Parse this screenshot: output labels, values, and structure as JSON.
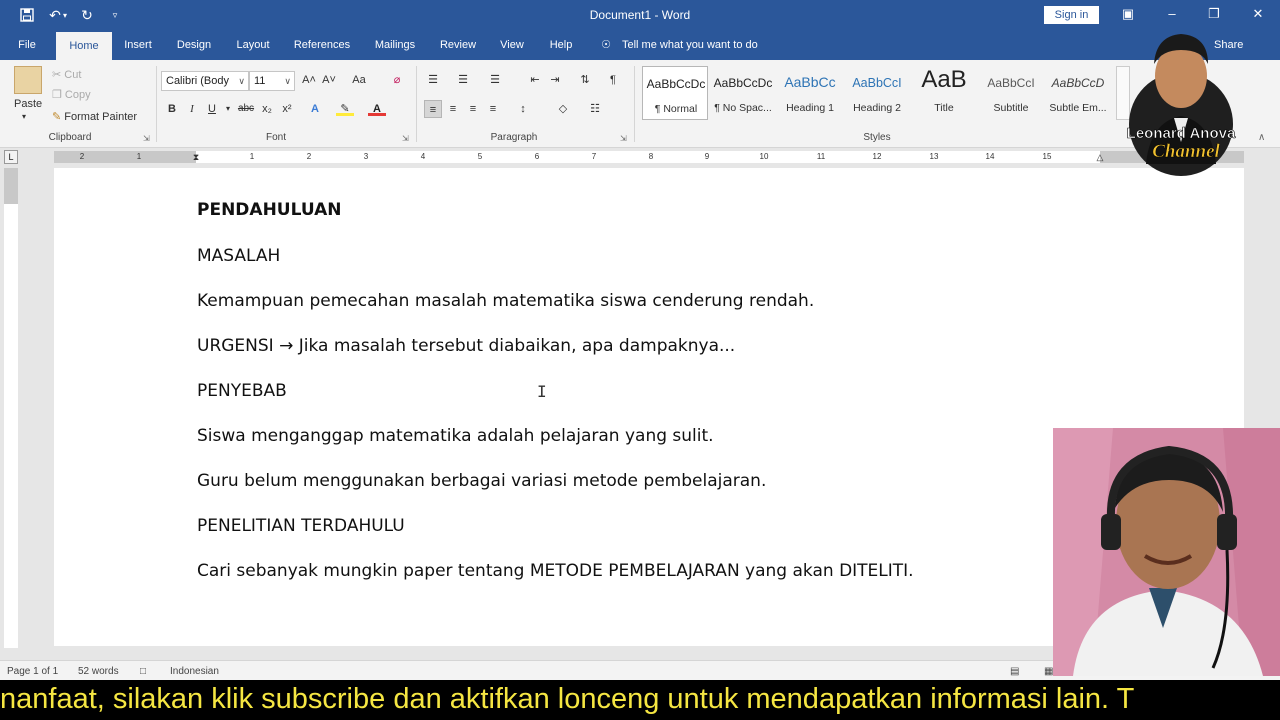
{
  "window": {
    "title": "Document1  -  Word",
    "sign_in": "Sign in",
    "quick_access": [
      "save-icon",
      "undo-icon",
      "redo-icon",
      "customize-icon"
    ]
  },
  "tabs": [
    {
      "label": "File",
      "active": false
    },
    {
      "label": "Home",
      "active": true
    },
    {
      "label": "Insert",
      "active": false
    },
    {
      "label": "Design",
      "active": false
    },
    {
      "label": "Layout",
      "active": false
    },
    {
      "label": "References",
      "active": false
    },
    {
      "label": "Mailings",
      "active": false
    },
    {
      "label": "Review",
      "active": false
    },
    {
      "label": "View",
      "active": false
    },
    {
      "label": "Help",
      "active": false
    }
  ],
  "tell_me": "Tell me what you want to do",
  "share": "Share",
  "ribbon": {
    "clipboard": {
      "label": "Clipboard",
      "paste": "Paste",
      "cut": "Cut",
      "copy": "Copy",
      "format_painter": "Format Painter"
    },
    "font": {
      "label": "Font",
      "family": "Calibri (Body",
      "size": "11",
      "bold": "B",
      "italic": "I",
      "underline": "U",
      "strike": "abc",
      "subscript": "x₂",
      "superscript": "x²",
      "grow": "A˄",
      "shrink": "A˅",
      "case": "Aa"
    },
    "paragraph": {
      "label": "Paragraph"
    },
    "styles": {
      "label": "Styles",
      "items": [
        {
          "preview": "AaBbCcDc",
          "name": "¶ Normal",
          "selected": true
        },
        {
          "preview": "AaBbCcDc",
          "name": "¶ No Spac...",
          "selected": false
        },
        {
          "preview": "AaBbCc",
          "name": "Heading 1",
          "selected": false
        },
        {
          "preview": "AaBbCcI",
          "name": "Heading 2",
          "selected": false
        },
        {
          "preview": "AaB",
          "name": "Title",
          "selected": false
        },
        {
          "preview": "AaBbCcI",
          "name": "Subtitle",
          "selected": false
        },
        {
          "preview": "AaBbCcD",
          "name": "Subtle Em...",
          "selected": false
        }
      ]
    }
  },
  "ruler": {
    "numbers": [
      "2",
      "1",
      "1",
      "1",
      "2",
      "3",
      "4",
      "5",
      "6",
      "7",
      "8",
      "9",
      "10",
      "11",
      "12",
      "13",
      "14",
      "15"
    ]
  },
  "document": {
    "paragraphs": [
      {
        "text": "PENDAHULUAN",
        "bold": true
      },
      {
        "text": "MASALAH",
        "bold": false
      },
      {
        "text": "Kemampuan pemecahan masalah matematika siswa cenderung rendah.",
        "bold": false
      },
      {
        "text": "URGENSI → Jika masalah tersebut diabaikan, apa dampaknya...",
        "bold": false
      },
      {
        "text": "PENYEBAB",
        "bold": false
      },
      {
        "text": "Siswa menganggap matematika adalah pelajaran yang sulit.",
        "bold": false
      },
      {
        "text": "Guru belum menggunakan berbagai variasi metode pembelajaran.",
        "bold": false
      },
      {
        "text": "PENELITIAN TERDAHULU",
        "bold": false
      },
      {
        "text": "Cari sebanyak mungkin paper tentang METODE PEMBELAJARAN yang akan DITELITI.",
        "bold": false
      }
    ]
  },
  "status": {
    "page": "Page 1 of 1",
    "words": "52 words",
    "language": "Indonesian"
  },
  "overlay": {
    "channel_line1": "Leonard Anova",
    "channel_line2": "Channel",
    "ticker": "nanfaat, silakan klik subscribe dan aktifkan lonceng untuk mendapatkan informasi lain. T"
  },
  "colors": {
    "word_blue": "#2b579a",
    "ribbon_bg": "#f3f3f3",
    "ticker_text": "#f5e642"
  }
}
